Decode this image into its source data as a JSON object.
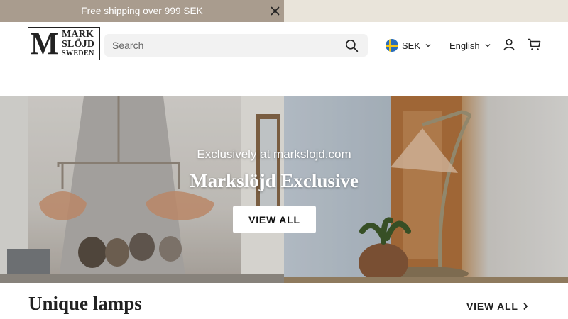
{
  "announcement": {
    "text": "Free shipping over 999 SEK",
    "colors": {
      "left": "#a99c8e",
      "right": "#e9e4da"
    }
  },
  "header": {
    "logo": {
      "line1": "MARK",
      "line2": "SLÖJD",
      "line3": "SWEDEN",
      "monogram": "M"
    },
    "search": {
      "placeholder": "Search",
      "value": ""
    },
    "currency": {
      "label": "SEK",
      "flag": "sweden-flag-icon"
    },
    "language": {
      "label": "English"
    },
    "icons": {
      "search": "search-icon",
      "account": "account-icon",
      "cart": "cart-icon",
      "close": "close-icon"
    }
  },
  "hero": {
    "subtitle": "Exclusively at markslojd.com",
    "title": "Markslöjd Exclusive",
    "button_label": "VIEW ALL"
  },
  "section": {
    "title": "Unique lamps",
    "link_label": "VIEW ALL"
  }
}
